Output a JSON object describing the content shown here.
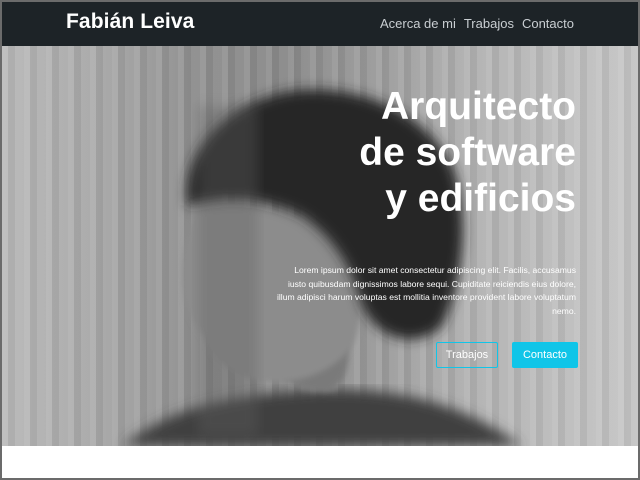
{
  "navbar": {
    "brand": "Fabián Leiva",
    "links": [
      {
        "label": "Acerca de mi"
      },
      {
        "label": "Trabajos"
      },
      {
        "label": "Contacto"
      }
    ]
  },
  "hero": {
    "title_lines": [
      "Arquitecto",
      "de software",
      "y edificios"
    ],
    "text": "Lorem ipsum dolor sit amet consectetur adipiscing elit. Facilis, accusamus iusto quibusdam dignissimos labore sequi. Cupiditate reiciendis eius dolore, illum adipisci harum voluptas est mollitia inventore provident labore voluptatum nemo.",
    "buttons": {
      "secondary": "Trabajos",
      "primary": "Contacto"
    }
  },
  "colors": {
    "navbar_bg": "#1d2327",
    "accent": "#10c5e8",
    "text": "#ffffff"
  }
}
